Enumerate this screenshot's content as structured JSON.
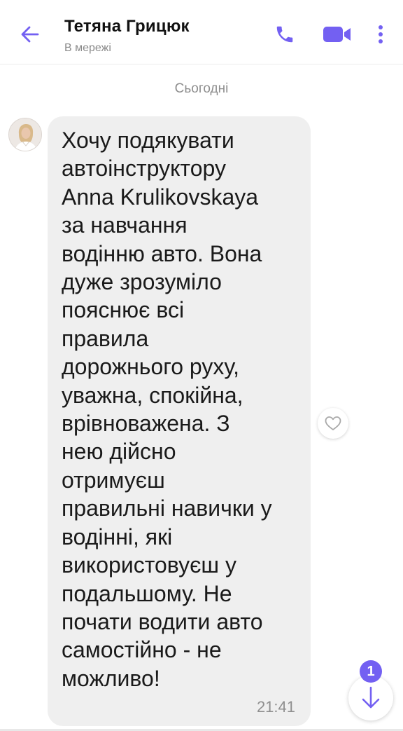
{
  "header": {
    "contact_name": "Тетяна Грицюк",
    "status": "В мережі",
    "icons": {
      "back": "arrow-left-icon",
      "call": "phone-icon",
      "video": "video-camera-icon",
      "more": "more-vertical-icon"
    }
  },
  "chat": {
    "date_separator": "Сьогодні",
    "messages": [
      {
        "text": "Хочу подякувати\nавтоінструктору\nAnna Krulikovskaya\nза навчання\nводінню авто. Вона\nдуже зрозуміло\nпояснює всі\nправила\nдорожнього руху,\nуважна, спокійна,\nврівноважена. З\nнею дійсно\nотримуєш\nправильні навички у\nводінні, які\nвикористовуєш у\nподальшому. Не\nпочати водити авто\nсамостійно - не\nможливо!",
        "time": "21:41"
      }
    ]
  },
  "scroll_button": {
    "unread_count": "1"
  },
  "colors": {
    "accent": "#7360f2",
    "bubble": "#efefef",
    "muted_text": "#8e8e8e"
  }
}
